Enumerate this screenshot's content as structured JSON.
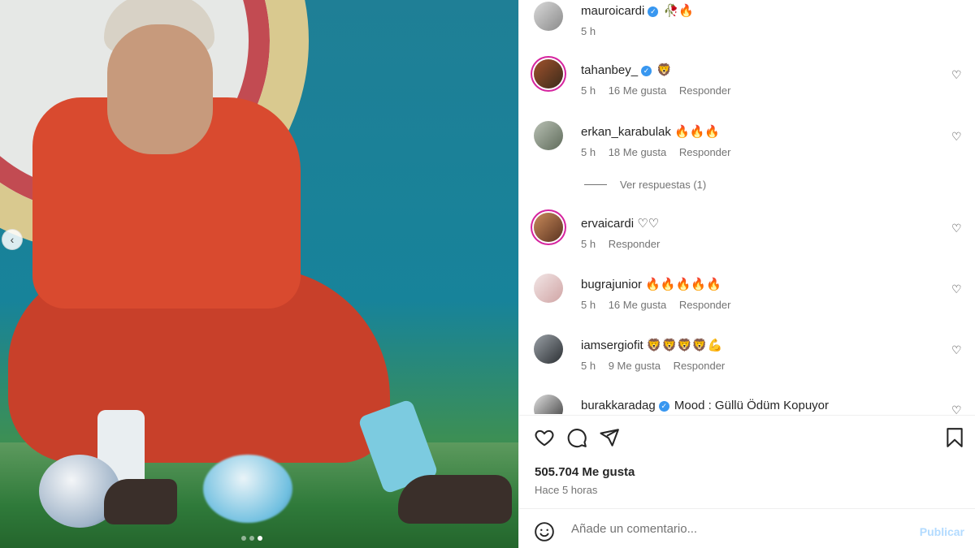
{
  "photo": {
    "icons": {
      "prev": "chevron-left-icon"
    },
    "carousel": {
      "count": 3,
      "active": 3
    }
  },
  "post_owner": {
    "username": "mauroicardi",
    "verified": true,
    "caption": "🥀🔥",
    "time": "5 h"
  },
  "comments": [
    {
      "username": "tahanbey_",
      "verified": true,
      "text": "🦁",
      "time": "5 h",
      "likes": "16 Me gusta",
      "reply": "Responder",
      "story": true
    },
    {
      "username": "erkan_karabulak",
      "verified": false,
      "text": "🔥🔥🔥",
      "time": "5 h",
      "likes": "18 Me gusta",
      "reply": "Responder",
      "story": false
    },
    {
      "username": "ervaicardi",
      "verified": false,
      "text": "♡♡",
      "time": "5 h",
      "likes": "",
      "reply": "Responder",
      "story": true
    },
    {
      "username": "bugrajunior",
      "verified": false,
      "text": "🔥🔥🔥🔥🔥",
      "time": "5 h",
      "likes": "16 Me gusta",
      "reply": "Responder",
      "story": false
    },
    {
      "username": "iamsergiofit",
      "verified": false,
      "text": "🦁🦁🦁🦁💪",
      "time": "5 h",
      "likes": "9 Me gusta",
      "reply": "Responder",
      "story": false
    },
    {
      "username": "burakkaradag",
      "verified": true,
      "text": "Mood : Güllü Ödüm Kopuyor",
      "time": "",
      "likes": "",
      "reply": "",
      "story": false
    }
  ],
  "view_replies": "Ver respuestas (1)",
  "actions": {
    "likes": "505.704 Me gusta",
    "time_ago": "Hace 5 horas",
    "icons": [
      "heart-icon",
      "comment-icon",
      "share-icon",
      "bookmark-icon"
    ]
  },
  "composer": {
    "placeholder": "Añade un comentario...",
    "publish": "Publicar"
  },
  "colors": {
    "verified": "#3897f0",
    "muted": "#737373",
    "publish_disabled": "#b3dbff"
  }
}
